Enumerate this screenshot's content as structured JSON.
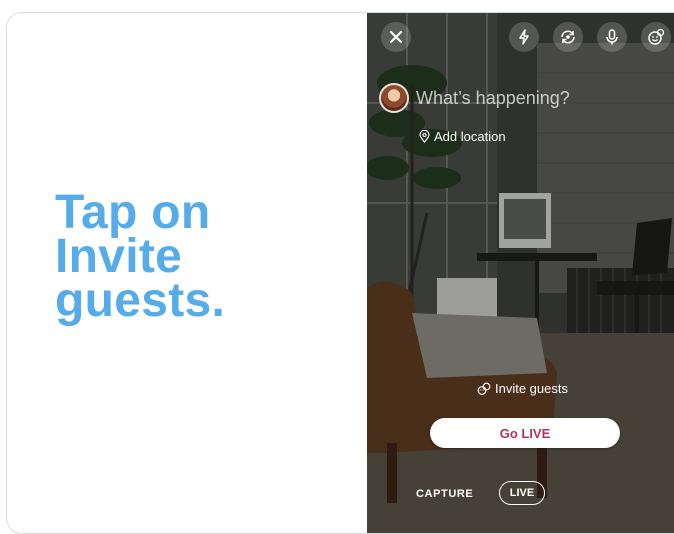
{
  "headline": {
    "line1": "Tap on",
    "line2": "Invite",
    "line3": "guests."
  },
  "camera": {
    "top_icons": [
      "close-icon",
      "flash-icon",
      "flip-camera-icon",
      "microphone-icon",
      "emoji-icon"
    ],
    "composer_placeholder": "What’s happening?",
    "add_location_label": "Add location",
    "invite_guests_label": "Invite guests",
    "go_live_label": "Go LIVE",
    "modes": {
      "capture": "CAPTURE",
      "live": "LIVE"
    }
  },
  "colors": {
    "headline": "#55ace9",
    "go_live_text": "#b0345f",
    "card_border": "#d3dde6"
  }
}
